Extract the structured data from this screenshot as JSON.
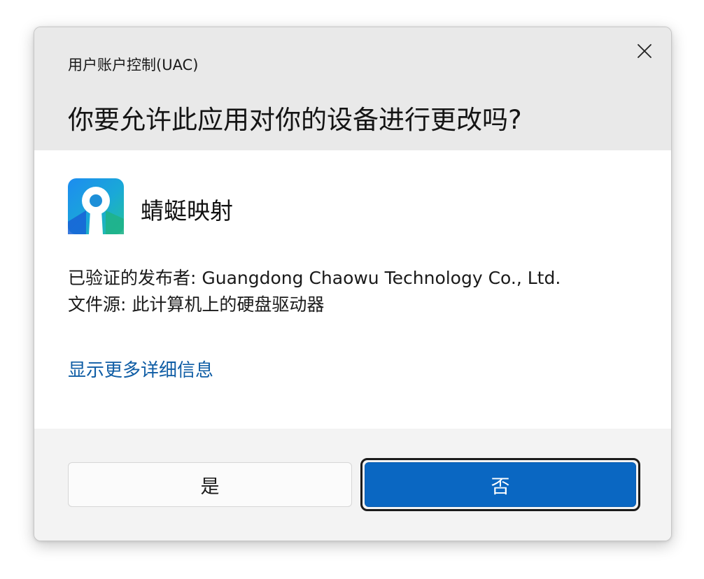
{
  "dialog": {
    "subtitle": "用户账户控制(UAC)",
    "title": "你要允许此应用对你的设备进行更改吗?",
    "close_icon": "close-icon"
  },
  "app": {
    "icon": "app-logo-icon",
    "name": "蜻蜓映射"
  },
  "details": {
    "publisher_line": "已验证的发布者: Guangdong Chaowu Technology Co., Ltd.",
    "source_line": "文件源: 此计算机上的硬盘驱动器",
    "more_link": "显示更多详细信息"
  },
  "buttons": {
    "yes_label": "是",
    "no_label": "否"
  },
  "colors": {
    "accent": "#0a67c2",
    "link": "#0f5da5",
    "header_bg": "#e9e9e9",
    "body_bg": "#ffffff",
    "footer_bg": "#f3f3f3"
  }
}
